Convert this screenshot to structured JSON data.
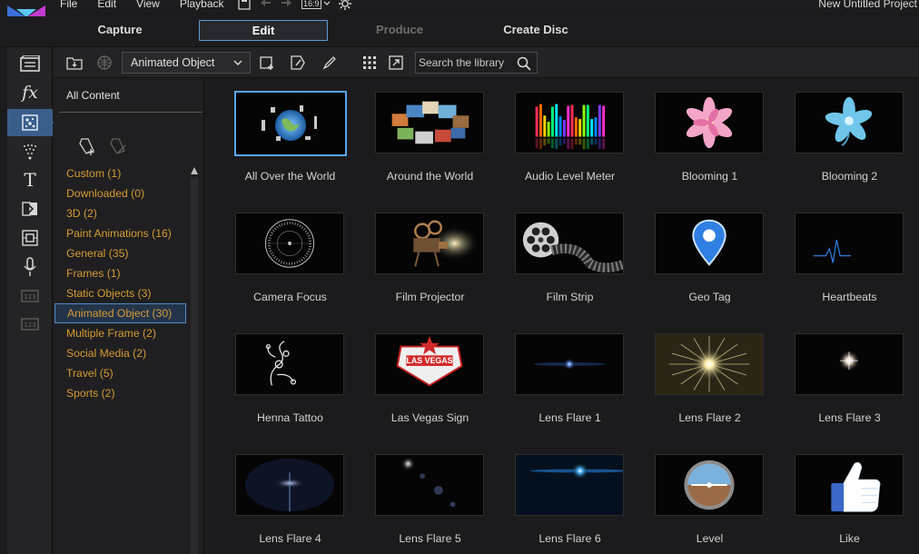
{
  "app": {
    "project_title": "New Untitled Project"
  },
  "menu": [
    "File",
    "Edit",
    "View",
    "Playback"
  ],
  "aspect_ratio": "16:9",
  "modes": [
    {
      "label": "Capture",
      "state": "normal"
    },
    {
      "label": "Edit",
      "state": "active"
    },
    {
      "label": "Produce",
      "state": "disabled"
    },
    {
      "label": "Create Disc",
      "state": "normal"
    }
  ],
  "toolbar": {
    "category_value": "Animated Object",
    "search_placeholder": "Search the library"
  },
  "categories": {
    "all_label": "All Content",
    "items": [
      {
        "label": "Custom  (1)"
      },
      {
        "label": "Downloaded  (0)"
      },
      {
        "label": "3D  (2)"
      },
      {
        "label": "Paint Animations  (16)"
      },
      {
        "label": "General  (35)"
      },
      {
        "label": "Frames  (1)"
      },
      {
        "label": "Static Objects  (3)"
      },
      {
        "label": "Animated Object  (30)",
        "selected": true
      },
      {
        "label": "Multiple Frame  (2)"
      },
      {
        "label": "Social Media  (2)"
      },
      {
        "label": "Travel  (5)"
      },
      {
        "label": "Sports  (2)"
      }
    ]
  },
  "library": {
    "items": [
      {
        "label": "All Over the World",
        "thumb": "globe",
        "selected": true
      },
      {
        "label": "Around the World",
        "thumb": "photo-ring"
      },
      {
        "label": "Audio Level Meter",
        "thumb": "equalizer"
      },
      {
        "label": "Blooming 1",
        "thumb": "pink-flower"
      },
      {
        "label": "Blooming 2",
        "thumb": "blue-flower"
      },
      {
        "label": "Camera Focus",
        "thumb": "focus-ring"
      },
      {
        "label": "Film Projector",
        "thumb": "projector"
      },
      {
        "label": "Film Strip",
        "thumb": "film-reel"
      },
      {
        "label": "Geo Tag",
        "thumb": "map-pin"
      },
      {
        "label": "Heartbeats",
        "thumb": "heartbeat"
      },
      {
        "label": "Henna Tattoo",
        "thumb": "henna"
      },
      {
        "label": "Las Vegas Sign",
        "thumb": "vegas-sign"
      },
      {
        "label": "Lens Flare 1",
        "thumb": "flare-small"
      },
      {
        "label": "Lens Flare 2",
        "thumb": "flare-burst"
      },
      {
        "label": "Lens Flare 3",
        "thumb": "flare-star"
      },
      {
        "label": "Lens Flare 4",
        "thumb": "flare-haze"
      },
      {
        "label": "Lens Flare 5",
        "thumb": "flare-corner"
      },
      {
        "label": "Lens Flare 6",
        "thumb": "flare-blue"
      },
      {
        "label": "Level",
        "thumb": "level-gauge"
      },
      {
        "label": "Like",
        "thumb": "thumbs-up"
      }
    ]
  },
  "colors": {
    "accent": "#58a6ea",
    "category_text": "#d79b33",
    "rail_active": "#3a5e8a"
  }
}
